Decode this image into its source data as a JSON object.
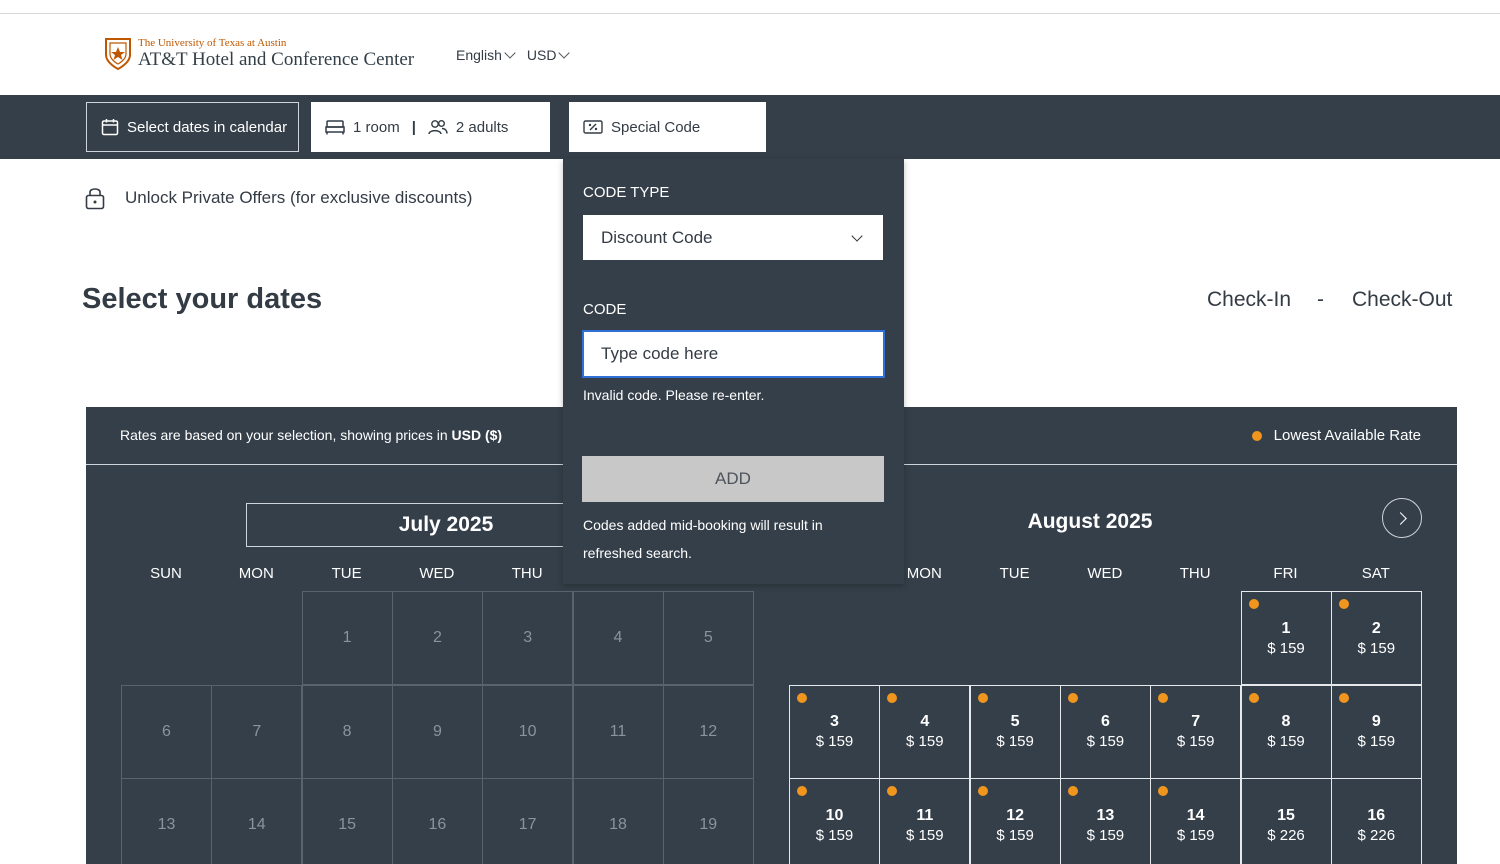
{
  "header": {
    "university": "The University of Texas at Austin",
    "hotel_name": "AT&T Hotel and Conference Center",
    "language": "English",
    "currency": "USD"
  },
  "booking_bar": {
    "dates_label": "Select dates in calendar",
    "rooms_label": "1 room",
    "guests_label": "2 adults",
    "code_label": "Special Code"
  },
  "private_offers": "Unlock Private Offers (for exclusive discounts)",
  "page": {
    "title": "Select your dates",
    "check_in": "Check-In",
    "dash": "-",
    "check_out": "Check-Out"
  },
  "calendar": {
    "rates_prefix": "Rates are based on your selection, showing prices in ",
    "rates_currency": "USD ($)",
    "legend": "Lowest Available Rate",
    "july_title": "July 2025",
    "august_title": "August 2025",
    "july_days": [
      "SUN",
      "MON",
      "TUE",
      "WED",
      "THU"
    ],
    "august_days": [
      "MON",
      "TUE",
      "WED",
      "THU",
      "FRI",
      "SAT"
    ],
    "july_dates": [
      [
        "",
        "",
        "1",
        "2",
        "3",
        "4",
        "5"
      ],
      [
        "6",
        "7",
        "8",
        "9",
        "10",
        "11",
        "12"
      ],
      [
        "13",
        "14",
        "15",
        "16",
        "17",
        "18",
        "19"
      ]
    ],
    "august_cells": [
      [
        null,
        null,
        null,
        null,
        null,
        {
          "d": "1",
          "p": "$ 159",
          "low": true
        },
        {
          "d": "2",
          "p": "$ 159",
          "low": true
        }
      ],
      [
        {
          "d": "3",
          "p": "$ 159",
          "low": true
        },
        {
          "d": "4",
          "p": "$ 159",
          "low": true
        },
        {
          "d": "5",
          "p": "$ 159",
          "low": true
        },
        {
          "d": "6",
          "p": "$ 159",
          "low": true
        },
        {
          "d": "7",
          "p": "$ 159",
          "low": true
        },
        {
          "d": "8",
          "p": "$ 159",
          "low": true
        },
        {
          "d": "9",
          "p": "$ 159",
          "low": true
        }
      ],
      [
        {
          "d": "10",
          "p": "$ 159",
          "low": true
        },
        {
          "d": "11",
          "p": "$ 159",
          "low": true
        },
        {
          "d": "12",
          "p": "$ 159",
          "low": true
        },
        {
          "d": "13",
          "p": "$ 159",
          "low": true
        },
        {
          "d": "14",
          "p": "$ 159",
          "low": true
        },
        {
          "d": "15",
          "p": "$ 226",
          "low": false
        },
        {
          "d": "16",
          "p": "$ 226",
          "low": false
        }
      ]
    ]
  },
  "popup": {
    "code_type_label": "CODE TYPE",
    "code_type_value": "Discount Code",
    "code_label": "CODE",
    "code_placeholder": "Type code here",
    "error": "Invalid code. Please re-enter.",
    "add_button": "ADD",
    "note": "Codes added mid-booking will result in refreshed search."
  },
  "colors": {
    "dark": "#353f49",
    "accent_orange": "#f0961e",
    "brand_orange": "#bf5700",
    "focus_blue": "#2f6fd6"
  }
}
